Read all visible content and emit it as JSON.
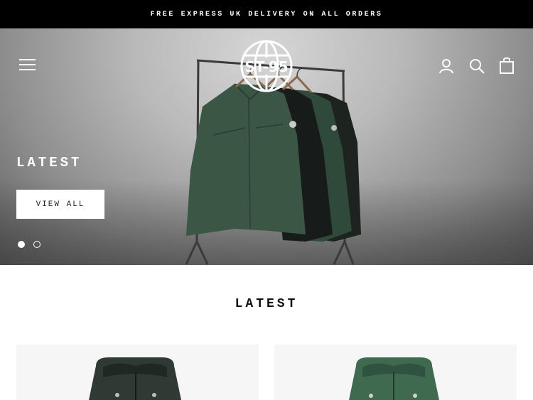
{
  "announcement": {
    "text": "FREE EXPRESS UK DELIVERY ON ALL ORDERS"
  },
  "header": {
    "logo_text": "ST-95",
    "icons": [
      "menu-icon",
      "account-icon",
      "search-icon",
      "cart-icon"
    ]
  },
  "hero": {
    "title": "LATEST",
    "button_label": "VIEW ALL",
    "slides": {
      "count": 2,
      "active": 1
    }
  },
  "section": {
    "title": "LATEST"
  },
  "products": [
    {
      "image": "dark-green-hooded-jacket",
      "color": "#2e3a33"
    },
    {
      "image": "green-hooded-jacket",
      "color": "#3f6a4f"
    }
  ],
  "colors": {
    "announcement_bg": "#000000",
    "jacket_green": "#3d5a45",
    "jacket_dark": "#1f2a24"
  }
}
